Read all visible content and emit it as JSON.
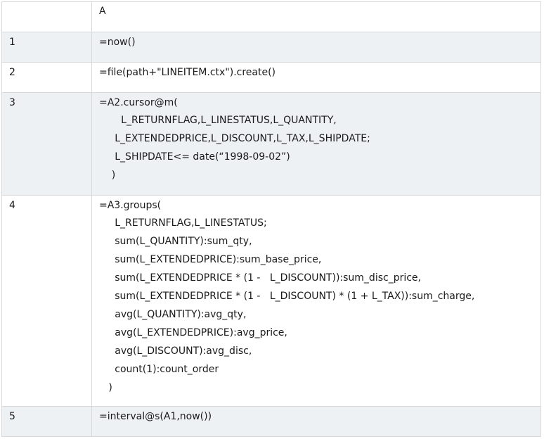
{
  "header": {
    "corner": "",
    "column": "A"
  },
  "rows": [
    {
      "num": "1",
      "lines": [
        "=now()"
      ]
    },
    {
      "num": "2",
      "lines": [
        "=file(path+\"LINEITEM.ctx\").create()"
      ]
    },
    {
      "num": "3",
      "lines": [
        "=A2.cursor@m(",
        "       L_RETURNFLAG,L_LINESTATUS,L_QUANTITY,",
        "     L_EXTENDEDPRICE,L_DISCOUNT,L_TAX,L_SHIPDATE;",
        "     L_SHIPDATE<= date(“1998-09-02”)",
        "    )"
      ]
    },
    {
      "num": "4",
      "lines": [
        "=A3.groups(",
        "     L_RETURNFLAG,L_LINESTATUS;",
        "     sum(L_QUANTITY):sum_qty,",
        "     sum(L_EXTENDEDPRICE):sum_base_price,",
        "     sum(L_EXTENDEDPRICE * (1 -   L_DISCOUNT)):sum_disc_price,",
        "     sum(L_EXTENDEDPRICE * (1 -   L_DISCOUNT) * (1 + L_TAX)):sum_charge,",
        "     avg(L_QUANTITY):avg_qty,",
        "     avg(L_EXTENDEDPRICE):avg_price,",
        "     avg(L_DISCOUNT):avg_disc,",
        "     count(1):count_order",
        "   )"
      ]
    },
    {
      "num": "5",
      "lines": [
        "=interval@s(A1,now())"
      ]
    }
  ]
}
